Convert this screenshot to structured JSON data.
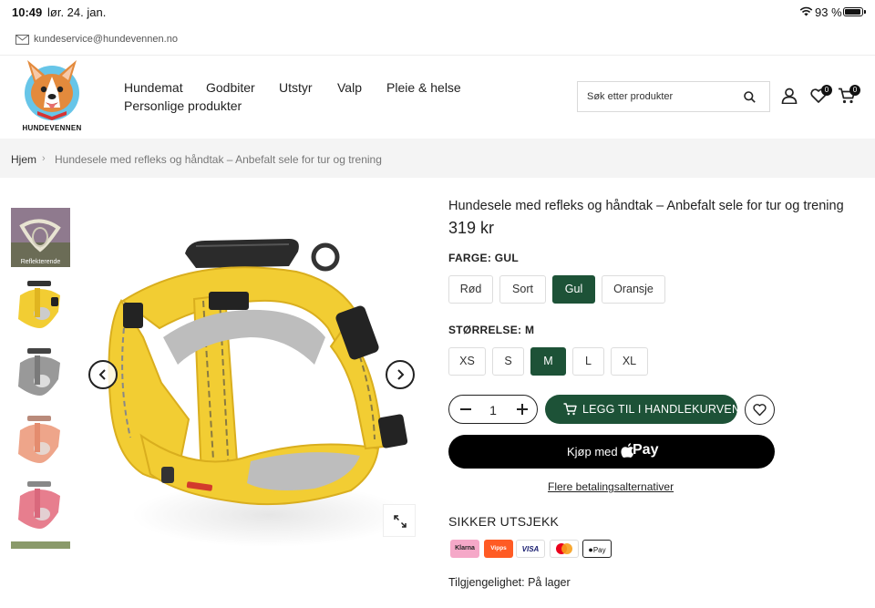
{
  "status_bar": {
    "time": "10:49",
    "date": "lør. 24. jan.",
    "battery_text": "93 %",
    "battery_level": 0.93
  },
  "top_bar": {
    "email": "kundeservice@hundevennen.no"
  },
  "logo": {
    "text": "HUNDEVENNEN"
  },
  "nav": {
    "items": [
      "Hundemat",
      "Godbiter",
      "Utstyr",
      "Valp",
      "Pleie & helse",
      "Personlige produkter"
    ]
  },
  "search": {
    "placeholder": "Søk etter produkter"
  },
  "header": {
    "wishlist_count": "0",
    "cart_count": "0"
  },
  "breadcrumb": {
    "home": "Hjem",
    "current": "Hundesele med refleks og håndtak – Anbefalt sele for tur og trening"
  },
  "gallery": {
    "first_thumb_caption": "Reflekterende"
  },
  "product": {
    "title": "Hundesele med refleks og håndtak – Anbefalt sele for tur og trening",
    "price": "319 kr",
    "color_label": "FARGE: GUL",
    "colors": [
      "Rød",
      "Sort",
      "Gul",
      "Oransje"
    ],
    "selected_color": "Gul",
    "size_label": "STØRRELSE: M",
    "sizes": [
      "XS",
      "S",
      "M",
      "L",
      "XL"
    ],
    "selected_size": "M",
    "quantity": "1",
    "add_to_cart": "LEGG TIL I HANDLEKURVEN",
    "buy_with": "Kjøp med",
    "pay_word": "Pay",
    "more_payment": "Flere betalingsalternativer",
    "secure_checkout": "SIKKER UTSJEKK",
    "payment_methods": [
      "Klarna",
      "Vipps",
      "VISA",
      "Mastercard",
      "Pay"
    ],
    "availability": "Tilgjengelighet: På lager"
  },
  "colors": {
    "accent_green": "#1d5237",
    "harness_yellow": "#f2cd33",
    "text": "#222222"
  }
}
